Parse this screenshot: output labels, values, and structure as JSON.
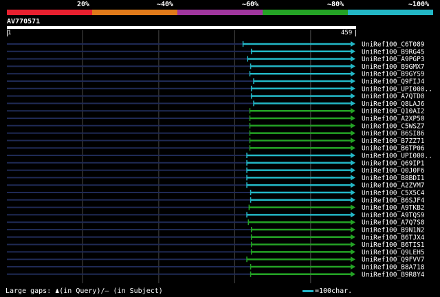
{
  "legend": {
    "labels": [
      "20%",
      "~40%",
      "~60%",
      "~80%",
      "~100%"
    ],
    "colors": [
      "#e8202f",
      "#e07a1a",
      "#a0369e",
      "#24a325",
      "#23b7c6"
    ]
  },
  "query": {
    "name": "AV770571",
    "start_label": "1",
    "end_label": "459",
    "length": 459
  },
  "footer": {
    "gaps_text": "Large gaps: ♟(in Query)/– (in Subject)",
    "scale_text": "=100char."
  },
  "colors": {
    "background": "#000000",
    "query_bar": "#ffffff",
    "cyan_hit": "#23b7c6",
    "green_hit": "#24a325",
    "unaligned": "#1f2a55",
    "grid": "#4a4a4a"
  },
  "chart_data": {
    "type": "alignment-overview",
    "query_length": 459,
    "grid_positions": [
      100,
      200,
      300,
      400
    ],
    "hits": [
      {
        "name": "UniRef100_C6T089",
        "start": 311,
        "end": 459,
        "color": "cyan"
      },
      {
        "name": "UniRef100_B9RG45",
        "start": 322,
        "end": 459,
        "color": "cyan"
      },
      {
        "name": "UniRef100_A9PGP3",
        "start": 317,
        "end": 459,
        "color": "cyan"
      },
      {
        "name": "UniRef100_B9GMX7",
        "start": 321,
        "end": 459,
        "color": "cyan"
      },
      {
        "name": "UniRef100_B9GYS9",
        "start": 320,
        "end": 459,
        "color": "cyan"
      },
      {
        "name": "UniRef100_Q9FIJ4",
        "start": 325,
        "end": 459,
        "color": "cyan"
      },
      {
        "name": "UniRef100_UPI000..",
        "start": 322,
        "end": 459,
        "color": "cyan"
      },
      {
        "name": "UniRef100_A7QTD0",
        "start": 322,
        "end": 459,
        "color": "cyan"
      },
      {
        "name": "UniRef100_Q8LAJ6",
        "start": 325,
        "end": 459,
        "color": "cyan"
      },
      {
        "name": "UniRef100_Q10AI2",
        "start": 320,
        "end": 459,
        "color": "green"
      },
      {
        "name": "UniRef100_A2XP50",
        "start": 320,
        "end": 459,
        "color": "green"
      },
      {
        "name": "UniRef100_C5WSZ7",
        "start": 320,
        "end": 459,
        "color": "green"
      },
      {
        "name": "UniRef100_B6SI86",
        "start": 320,
        "end": 459,
        "color": "green"
      },
      {
        "name": "UniRef100_B7ZZ71",
        "start": 320,
        "end": 459,
        "color": "green"
      },
      {
        "name": "UniRef100_B6TP06",
        "start": 320,
        "end": 459,
        "color": "green"
      },
      {
        "name": "UniRef100_UPI000..",
        "start": 316,
        "end": 459,
        "color": "cyan"
      },
      {
        "name": "UniRef100_Q69IP1",
        "start": 316,
        "end": 459,
        "color": "cyan"
      },
      {
        "name": "UniRef100_Q0J0F6",
        "start": 316,
        "end": 459,
        "color": "cyan"
      },
      {
        "name": "UniRef100_B8BDI1",
        "start": 316,
        "end": 459,
        "color": "cyan"
      },
      {
        "name": "UniRef100_A2ZVM7",
        "start": 316,
        "end": 459,
        "color": "cyan"
      },
      {
        "name": "UniRef100_C5X5C4",
        "start": 321,
        "end": 459,
        "color": "cyan"
      },
      {
        "name": "UniRef100_B6SJF4",
        "start": 321,
        "end": 459,
        "color": "cyan"
      },
      {
        "name": "UniRef100_A9TKB2",
        "start": 319,
        "end": 459,
        "color": "green"
      },
      {
        "name": "UniRef100_A9TQS9",
        "start": 316,
        "end": 459,
        "color": "cyan"
      },
      {
        "name": "UniRef100_A7Q7S8",
        "start": 318,
        "end": 459,
        "color": "green"
      },
      {
        "name": "UniRef100_B9N1N2",
        "start": 322,
        "end": 459,
        "color": "green"
      },
      {
        "name": "UniRef100_B6TJX4",
        "start": 322,
        "end": 459,
        "color": "green"
      },
      {
        "name": "UniRef100_B6TIS1",
        "start": 322,
        "end": 459,
        "color": "green"
      },
      {
        "name": "UniRef100_Q9LEH5",
        "start": 322,
        "end": 459,
        "color": "green"
      },
      {
        "name": "UniRef100_Q9FVV7",
        "start": 316,
        "end": 459,
        "color": "green"
      },
      {
        "name": "UniRef100_B8A718",
        "start": 321,
        "end": 459,
        "color": "green"
      },
      {
        "name": "UniRef100_B9R8Y4",
        "start": 321,
        "end": 459,
        "color": "green"
      }
    ]
  }
}
